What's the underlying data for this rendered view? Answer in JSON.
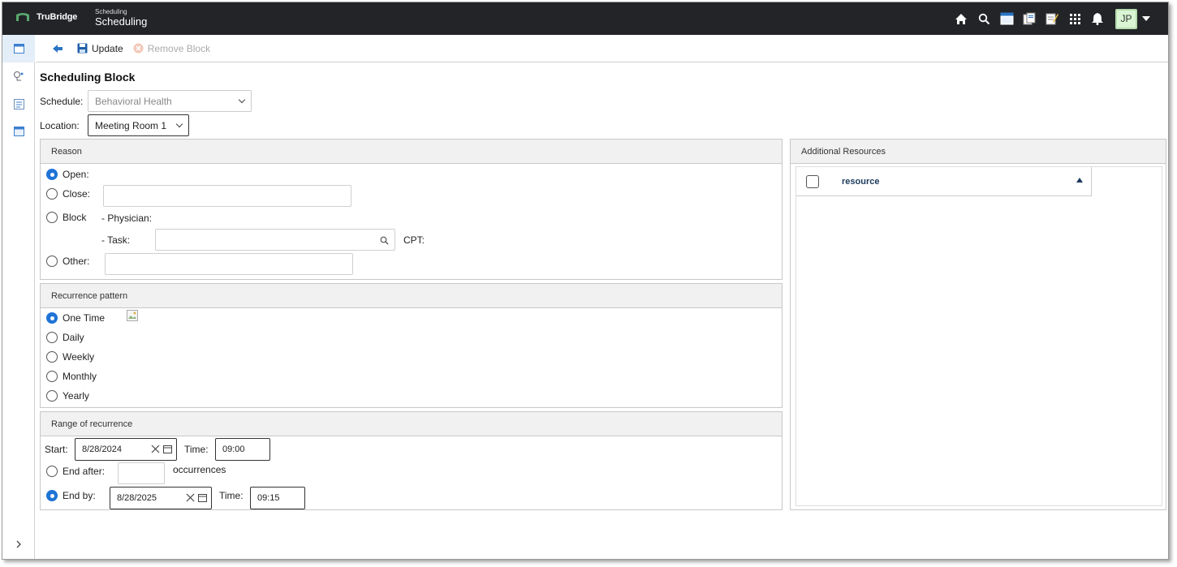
{
  "header": {
    "brand": "TruBridge",
    "module_small": "Scheduling",
    "module_title": "Scheduling",
    "user_initials": "JP",
    "icons": [
      "home-icon",
      "search-icon",
      "calendar-icon",
      "documents-icon",
      "notes-icon",
      "apps-grid-icon",
      "bell-icon"
    ]
  },
  "sidebar": {
    "items": [
      "calendar-icon",
      "stethoscope-icon",
      "schedule-list-icon",
      "calendar-alt-icon"
    ]
  },
  "toolbar": {
    "update_label": "Update",
    "remove_label": "Remove Block"
  },
  "page": {
    "title": "Scheduling Block",
    "schedule_label": "Schedule:",
    "schedule_value": "Behavioral Health",
    "location_label": "Location:",
    "location_value": "Meeting Room 1"
  },
  "reason": {
    "title": "Reason",
    "open_label": "Open:",
    "close_label": "Close:",
    "block_label": "Block",
    "physician_label": "- Physician:",
    "task_label": "- Task:",
    "cpt_label": "CPT:",
    "other_label": "Other:",
    "selected": "open"
  },
  "recurrence": {
    "title": "Recurrence pattern",
    "options": [
      "One Time",
      "Daily",
      "Weekly",
      "Monthly",
      "Yearly"
    ],
    "selected": "One Time"
  },
  "range": {
    "title": "Range of recurrence",
    "start_label": "Start:",
    "start_date": "8/28/2024",
    "time_label": "Time:",
    "start_time": "09:00",
    "end_after_label": "End after:",
    "occurrences_label": "occurrences",
    "end_by_label": "End by:",
    "end_date": "8/28/2025",
    "end_time_label": "Time:",
    "end_time": "09:15",
    "selected": "end_by"
  },
  "resources": {
    "title": "Additional Resources",
    "column": "resource"
  }
}
